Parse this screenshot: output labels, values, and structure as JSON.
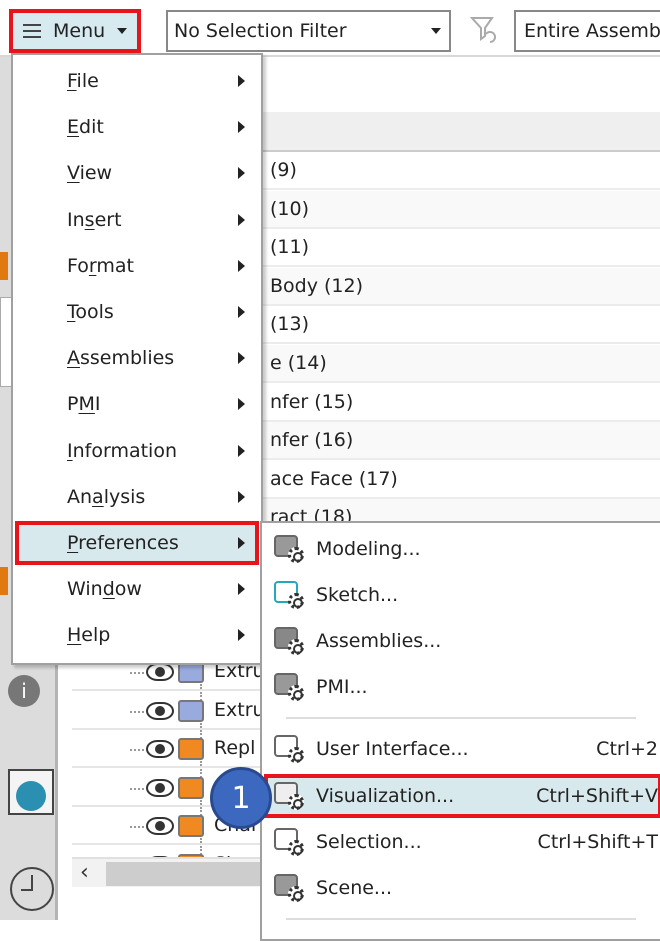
{
  "toolbar": {
    "menu_label": "Menu",
    "filter_value": "No Selection Filter",
    "scope_value": "Entire Assemb"
  },
  "icons": {
    "menu": "hamburger-icon",
    "funnel": "filter-reset-icon",
    "info": "info-icon",
    "globe": "globe-window-icon",
    "clock": "clock-icon"
  },
  "navigator_rows": [
    "(9)",
    "(10)",
    "(11)",
    "Body (12)",
    "(13)",
    "e (14)",
    "nfer (15)",
    "nfer (16)",
    "ace Face (17)",
    "ract (18)"
  ],
  "tree_rows": [
    "Extru",
    "Extru",
    "Repl",
    "",
    "Char",
    "Sh"
  ],
  "main_menu": [
    {
      "label": "File",
      "u": "F",
      "rest": "ile"
    },
    {
      "label": "Edit",
      "u": "E",
      "rest": "dit"
    },
    {
      "label": "View",
      "u": "V",
      "rest": "iew"
    },
    {
      "label": "Insert",
      "pre": "In",
      "u": "s",
      "rest": "ert"
    },
    {
      "label": "Format",
      "pre": "Fo",
      "u": "r",
      "rest": "mat"
    },
    {
      "label": "Tools",
      "u": "T",
      "rest": "ools"
    },
    {
      "label": "Assemblies",
      "u": "A",
      "rest": "ssemblies"
    },
    {
      "label": "PMI",
      "pre": "P",
      "u": "M",
      "rest": "I"
    },
    {
      "label": "Information",
      "u": "I",
      "rest": "nformation"
    },
    {
      "label": "Analysis",
      "pre": "An",
      "u": "a",
      "rest": "lysis"
    },
    {
      "label": "Preferences",
      "u": "P",
      "rest": "references"
    },
    {
      "label": "Window",
      "pre": "Win",
      "u": "d",
      "rest": "ow"
    },
    {
      "label": "Help",
      "u": "H",
      "rest": "elp"
    }
  ],
  "preferences_submenu": [
    {
      "label": "Modeling...",
      "shortcut": ""
    },
    {
      "label": "Sketch...",
      "shortcut": ""
    },
    {
      "label": "Assemblies...",
      "shortcut": ""
    },
    {
      "label": "PMI...",
      "shortcut": ""
    },
    {
      "label": "User Interface...",
      "shortcut": "Ctrl+2"
    },
    {
      "label": "Visualization...",
      "shortcut": "Ctrl+Shift+V"
    },
    {
      "label": "Selection...",
      "shortcut": "Ctrl+Shift+T"
    },
    {
      "label": "Scene...",
      "shortcut": ""
    }
  ],
  "badge": {
    "text": "1"
  },
  "colors": {
    "highlight_border": "#e8141c",
    "highlight_bg": "#d8e9ee",
    "badge": "#3d68c0"
  }
}
